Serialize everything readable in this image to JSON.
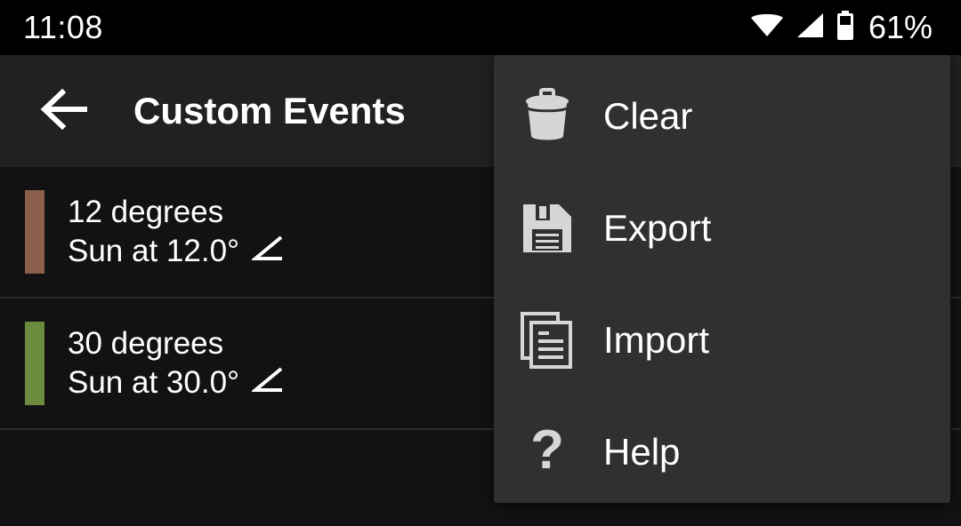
{
  "status_bar": {
    "clock": "11:08",
    "battery_percent": "61%",
    "icons": [
      "wifi-icon",
      "cell-signal-icon",
      "battery-icon"
    ]
  },
  "app_bar": {
    "back_icon": "back-arrow-icon",
    "title": "Custom Events"
  },
  "colors": {
    "background": "#121212",
    "app_bar": "#212121",
    "status_bar": "#000000",
    "menu_background": "#303030",
    "divider": "#2b2b2b",
    "text_primary": "#ffffff",
    "icon_tint": "#d6d6d6"
  },
  "events": [
    {
      "title": "12 degrees",
      "subtitle": "Sun at 12.0°",
      "angle_icon": "angle-icon",
      "color": "#8b5e4c"
    },
    {
      "title": "30 degrees",
      "subtitle": "Sun at 30.0°",
      "angle_icon": "angle-icon",
      "color": "#6b8c3f"
    }
  ],
  "menu": {
    "items": [
      {
        "label": "Clear",
        "icon": "trash-icon"
      },
      {
        "label": "Export",
        "icon": "floppy-save-icon"
      },
      {
        "label": "Import",
        "icon": "copy-documents-icon"
      },
      {
        "label": "Help",
        "icon": "question-mark-icon"
      }
    ]
  }
}
